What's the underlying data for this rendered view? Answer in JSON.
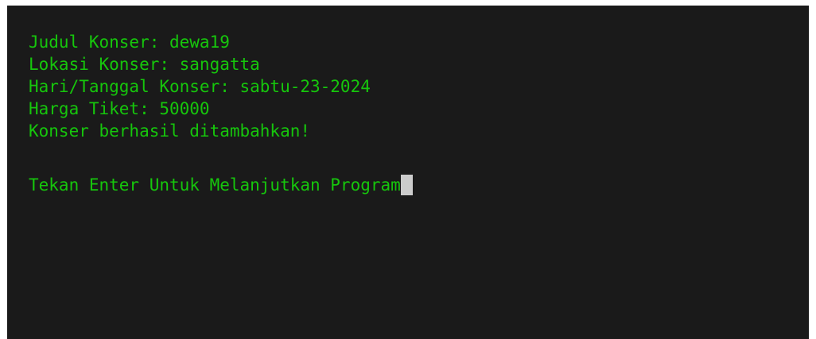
{
  "terminal": {
    "lines": [
      "Judul Konser: dewa19",
      "Lokasi Konser: sangatta",
      "Hari/Tanggal Konser: sabtu-23-2024",
      "Harga Tiket: 50000",
      "Konser berhasil ditambahkan!"
    ],
    "prompt": "Tekan Enter Untuk Melanjutkan Program",
    "colors": {
      "background": "#1a1a1a",
      "text": "#16c60c",
      "cursor": "#cccccc"
    }
  }
}
